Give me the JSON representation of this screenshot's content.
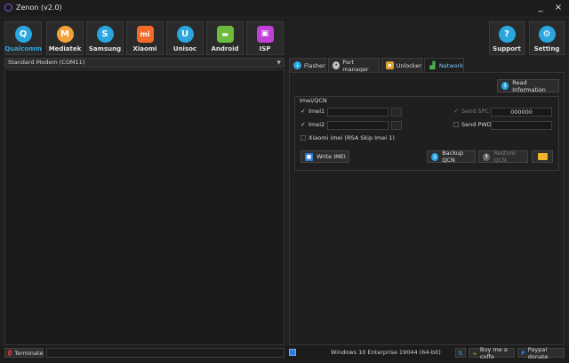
{
  "window": {
    "title": "Zenon (v2.0)",
    "minimize": "_",
    "close": "×"
  },
  "toolbar": [
    {
      "label": "Qualcomm",
      "glyph": "Q",
      "color": "#2aa6e0",
      "accent": "#2aa6e0"
    },
    {
      "label": "Mediatek",
      "glyph": "M",
      "color": "#f3a23a",
      "accent": "#ffffff"
    },
    {
      "label": "Samsung",
      "glyph": "S",
      "color": "#2aa6e0",
      "accent": "#ffffff"
    },
    {
      "label": "Xiaomi",
      "glyph": "mi",
      "color": "#f36b2a",
      "accent": "#ffffff"
    },
    {
      "label": "Unisoc",
      "glyph": "U",
      "color": "#2aa6e0",
      "accent": "#ffffff"
    },
    {
      "label": "Android",
      "glyph": "▬",
      "color": "#6dbb3c",
      "accent": "#ffffff"
    },
    {
      "label": "ISP",
      "glyph": "▣",
      "color": "#c040d8",
      "accent": "#ffffff"
    },
    {
      "label": "Support",
      "glyph": "?",
      "color": "#2aa6e0",
      "accent": "#ffffff"
    },
    {
      "label": "Setting",
      "glyph": "⚙",
      "color": "#2aa6e0",
      "accent": "#ffffff"
    }
  ],
  "port": {
    "selected": "Standard Modem (COM11)"
  },
  "tabs": [
    {
      "label": "Flasher",
      "icon": "download-icon",
      "color": "#2aa6e0"
    },
    {
      "label": "Part manager",
      "icon": "disk-icon",
      "color": "#bfbfbf"
    },
    {
      "label": "Unlocker",
      "icon": "lock-icon",
      "color": "#e0a030"
    },
    {
      "label": "Network",
      "icon": "signal-icon",
      "color": "#4caf50"
    }
  ],
  "network": {
    "read_info": "Read Information",
    "group_title": "Imei/QCN",
    "imei1": "Imei1",
    "imei2": "Imei2",
    "send_spc": "Send SPC",
    "spc_value": "000000",
    "send_pwd": "Send PWD",
    "xiaomi_imei": "Xiaomi imei (RSA Skip Imei 1)",
    "write_imei": "Write IMEI",
    "backup_qcn": "Backup QCN",
    "restore_qcn": "Restore QCN"
  },
  "status": {
    "terminate": "Terminate",
    "os": "Windows 10 Enterprise 19044 (64-bit)",
    "buy_coffee": "Buy me a coffe",
    "paypal": "Paypal donate"
  }
}
